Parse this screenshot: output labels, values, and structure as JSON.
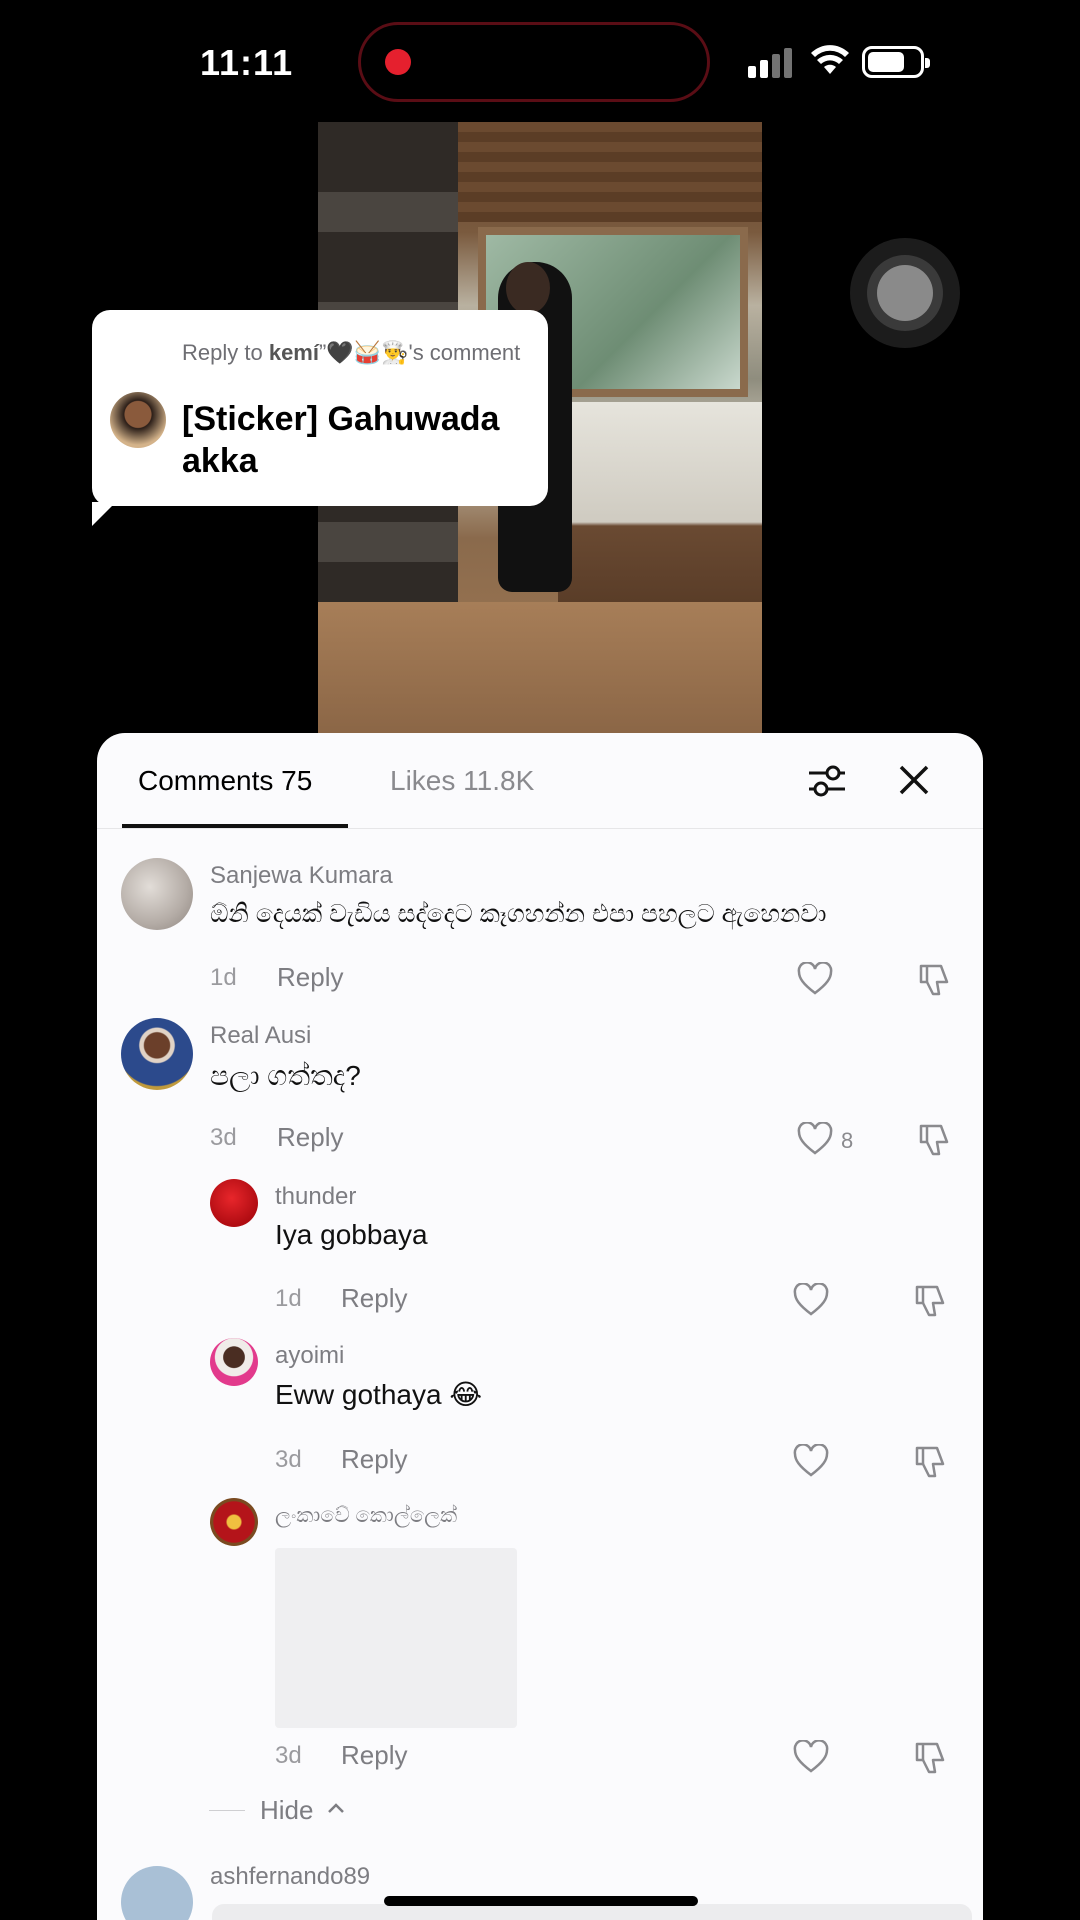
{
  "status_bar": {
    "time": "11:11"
  },
  "reply_bubble": {
    "reply_to_prefix": "Reply to ",
    "reply_to_user": "kemí",
    "reply_to_suffix": "”🖤🥁👨‍🍳's comment",
    "text": "[Sticker] Gahuwada akka"
  },
  "tabs": {
    "comments": "Comments 75",
    "likes": "Likes 11.8K"
  },
  "comments": [
    {
      "user": "Sanjewa Kumara",
      "text": "ඕනි දෙයක් වැඩිය සද්දෙට කෑගහන්න එපා පහලට ඇහෙනවා",
      "date": "1d",
      "reply": "Reply",
      "likes": ""
    },
    {
      "user": "Real Ausi",
      "text": "පලා ගත්තද?",
      "date": "3d",
      "reply": "Reply",
      "likes": "8"
    },
    {
      "user": "thunder",
      "text": "Iya gobbaya",
      "date": "1d",
      "reply": "Reply",
      "likes": ""
    },
    {
      "user": "ayoimi",
      "text": "Eww gothaya 😂",
      "date": "3d",
      "reply": "Reply",
      "likes": ""
    },
    {
      "user": "ලංකාවේ කොල්ලෙක්",
      "text": "",
      "date": "3d",
      "reply": "Reply",
      "likes": ""
    }
  ],
  "hide_label": "Hide",
  "next_user": "ashfernando89",
  "colors": {
    "accent_text": "#111111",
    "muted": "#7d7d82",
    "sheet_bg": "#fbfbfd"
  }
}
